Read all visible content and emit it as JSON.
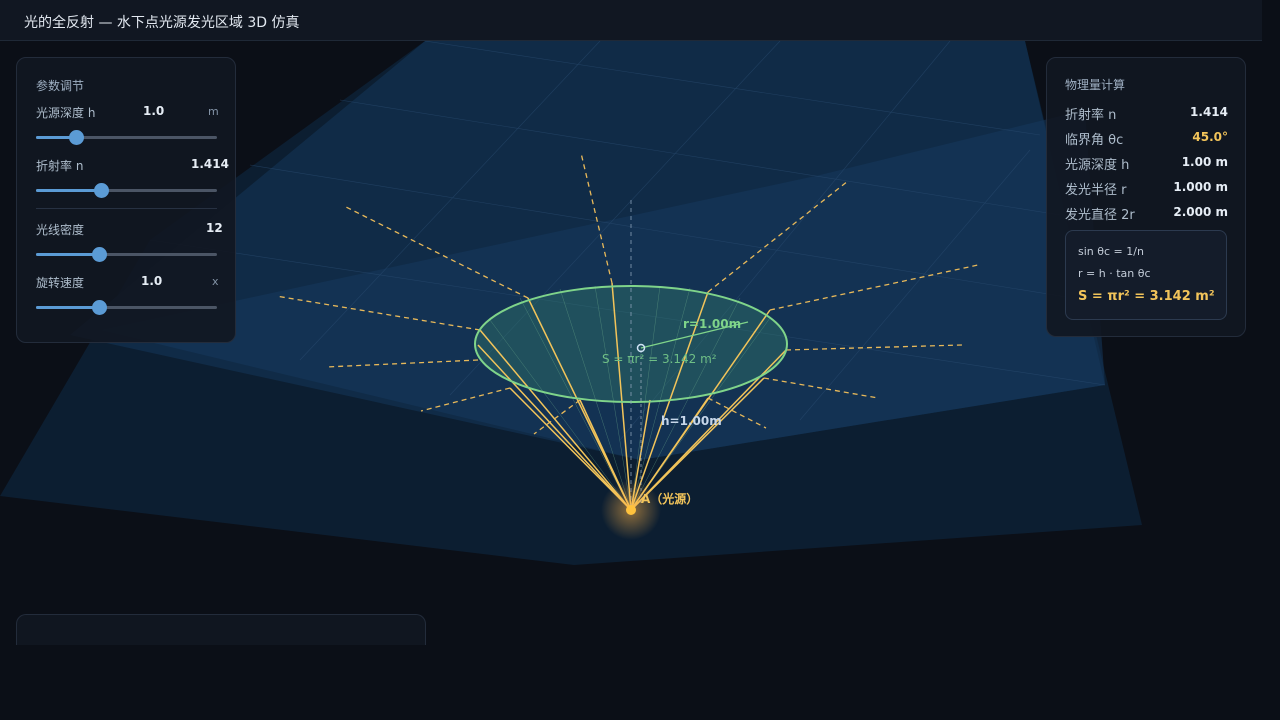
{
  "header": {
    "title": "光的全反射 — 水下点光源发光区域 3D 仿真"
  },
  "controls": {
    "title": "参数调节",
    "depth": {
      "label": "光源深度 h",
      "value": "1.0",
      "unit": "m",
      "fraction": 0.22
    },
    "index": {
      "label": "折射率 n",
      "value": "1.414",
      "fraction": 0.36
    },
    "density": {
      "label": "光线密度",
      "value": "12",
      "fraction": 0.35
    },
    "speed": {
      "label": "旋转速度",
      "value": "1.0",
      "unit": "x",
      "fraction": 0.35
    }
  },
  "physics": {
    "title": "物理量计算",
    "rows": [
      {
        "label": "折射率 n",
        "value": "1.414"
      },
      {
        "label": "临界角 θc",
        "value": "45.0°"
      },
      {
        "label": "光源深度 h",
        "value": "1.00 m"
      },
      {
        "label": "发光半径 r",
        "value": "1.000 m"
      },
      {
        "label": "发光直径 2r",
        "value": "2.000 m"
      }
    ],
    "formulas": {
      "f1": "sin θc = 1/n",
      "f2": "r = h · tan θc",
      "f3": "S = πr² = 3.142 m²"
    }
  },
  "scene": {
    "radius_label": "r=1.00m",
    "depth_label": "h=1.00m",
    "area_label": "S = πr² = 3.142 m²",
    "center_label": "O",
    "source_label": "A（光源）"
  },
  "colors": {
    "background": "#0b0f17",
    "accent": "#5b9bd5",
    "ray": "#f2c45a",
    "circle": "#7fd48a",
    "critical": "#f2c45a"
  }
}
